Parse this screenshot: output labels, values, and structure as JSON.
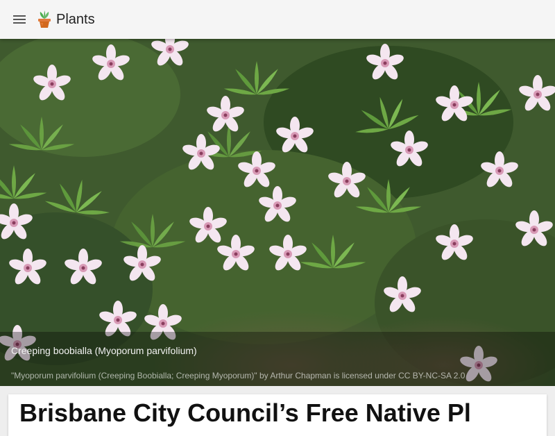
{
  "app_bar": {
    "menu_icon": "hamburger-menu-icon",
    "brand_icon": "potted-plant-icon",
    "title": "Plants"
  },
  "hero": {
    "caption_title": "Creeping boobialla (Myoporum parvifolium)",
    "caption_credit": "\"Myoporum parvifolium (Creeping Boobialla; Creeping Myoporum)\" by Arthur Chapman is licensed under CC BY-NC-SA 2.0"
  },
  "article": {
    "title": "Brisbane City Council’s Free Native Pl"
  },
  "colors": {
    "app_bar": "#f5f5f5",
    "background": "#eeeeee",
    "card": "#ffffff",
    "foliage_dark": "#3f5a2e",
    "leaf_green": "#6ea845",
    "flower_petal": "#f4e6f0",
    "flower_center": "#d89ab6"
  }
}
